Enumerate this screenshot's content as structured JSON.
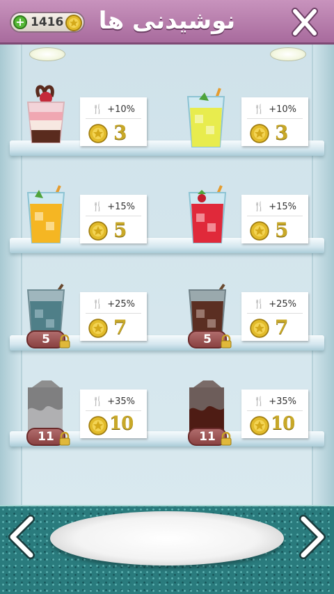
{
  "header": {
    "title": "نوشیدنی ها",
    "coins": "1416",
    "plus_icon": "plus-icon",
    "close_icon": "close-icon"
  },
  "colors": {
    "header": "#b47aa8",
    "counter": "#2a7b7d",
    "price_gold": "#c8a828",
    "lock_badge": "#9a5252"
  },
  "items": [
    {
      "drink": "chocolate-cherry-dessert",
      "bonus": "+10%",
      "price": "3",
      "locked": false
    },
    {
      "drink": "lemonade",
      "bonus": "+10%",
      "price": "3",
      "locked": false
    },
    {
      "drink": "orange-juice",
      "bonus": "+15%",
      "price": "5",
      "locked": false
    },
    {
      "drink": "strawberry-juice",
      "bonus": "+15%",
      "price": "5",
      "locked": false
    },
    {
      "drink": "iced-drink-locked",
      "bonus": "+25%",
      "price": "7",
      "locked": true,
      "unlock_level": "5"
    },
    {
      "drink": "cola-locked",
      "bonus": "+25%",
      "price": "7",
      "locked": true,
      "unlock_level": "5"
    },
    {
      "drink": "milk-carton-locked",
      "bonus": "+35%",
      "price": "10",
      "locked": true,
      "unlock_level": "11"
    },
    {
      "drink": "chocolate-milk-locked",
      "bonus": "+35%",
      "price": "10",
      "locked": true,
      "unlock_level": "11"
    }
  ],
  "nav": {
    "prev_icon": "chevron-left-icon",
    "next_icon": "chevron-right-icon"
  }
}
